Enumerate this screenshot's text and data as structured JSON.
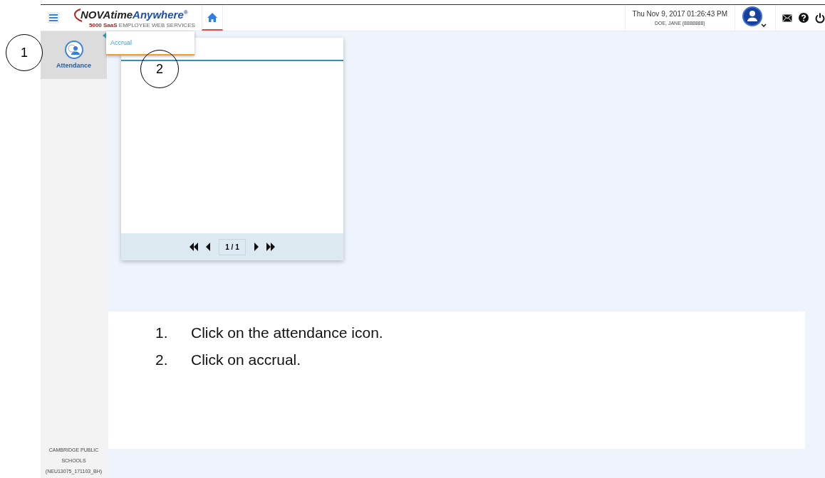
{
  "header": {
    "logo": {
      "brand": "NOVAtime",
      "brand_accent": "Anywhere",
      "registered": "®",
      "tagline_accent": "5000 SaaS",
      "tagline": "EMPLOYEE WEB SERVICES"
    },
    "datetime": "Thu Nov 9, 2017 01:26:43 PM",
    "user": "DOE, JANE (8888888)"
  },
  "sidebar": {
    "items": [
      {
        "label": "Attendance",
        "selected": true
      }
    ],
    "footer": [
      "CAMBRIDGE PUBLIC",
      "SCHOOLS",
      "(NEU13075_171103_BH)"
    ]
  },
  "submenu": {
    "items": [
      {
        "label": "Accrual",
        "selected": false
      }
    ]
  },
  "pager": {
    "page": "1 / 1"
  },
  "annotations": [
    "1",
    "2"
  ],
  "instructions": [
    {
      "number": "1.",
      "text": "Click on the attendance icon."
    },
    {
      "number": "2.",
      "text": "Click on accrual."
    }
  ]
}
